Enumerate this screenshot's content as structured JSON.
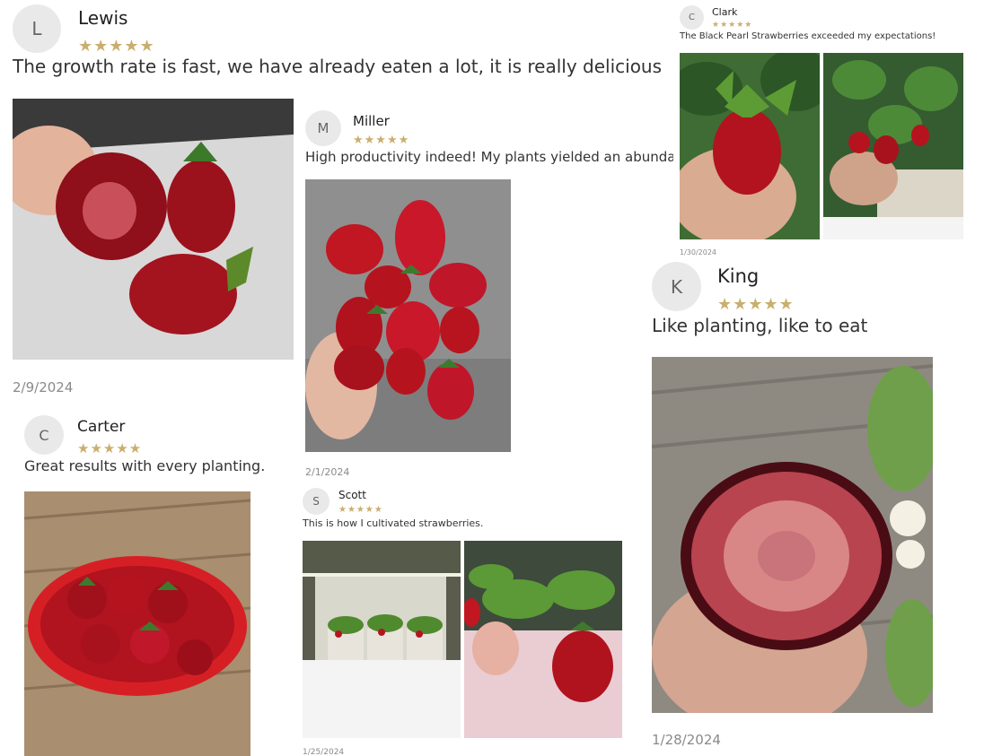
{
  "reviews": {
    "lewis": {
      "initial": "L",
      "name": "Lewis",
      "stars": "★★★★★",
      "text": "The growth rate is fast, we have already eaten a lot, it is really delicious",
      "date": "2/9/2024"
    },
    "miller": {
      "initial": "M",
      "name": "Miller",
      "stars": "★★★★★",
      "text": "High productivity indeed! My plants yielded an abundant",
      "date": "2/1/2024"
    },
    "clark": {
      "initial": "C",
      "name": "Clark",
      "stars": "★★★★★",
      "text": "The Black Pearl Strawberries exceeded my expectations!",
      "date": "1/30/2024"
    },
    "king": {
      "initial": "K",
      "name": "King",
      "stars": "★★★★★",
      "text": "Like planting, like to eat",
      "date": "1/28/2024"
    },
    "carter": {
      "initial": "C",
      "name": "Carter",
      "stars": "★★★★★",
      "text": "Great results with every planting.",
      "date": ""
    },
    "scott": {
      "initial": "S",
      "name": "Scott",
      "stars": "★★★★★",
      "text": "This is how I cultivated strawberries.",
      "date": "1/25/2024"
    }
  },
  "colors": {
    "star": "#c9ae6e",
    "avatar_bg": "#e9e9e9",
    "strawberry": "#b3121f"
  }
}
